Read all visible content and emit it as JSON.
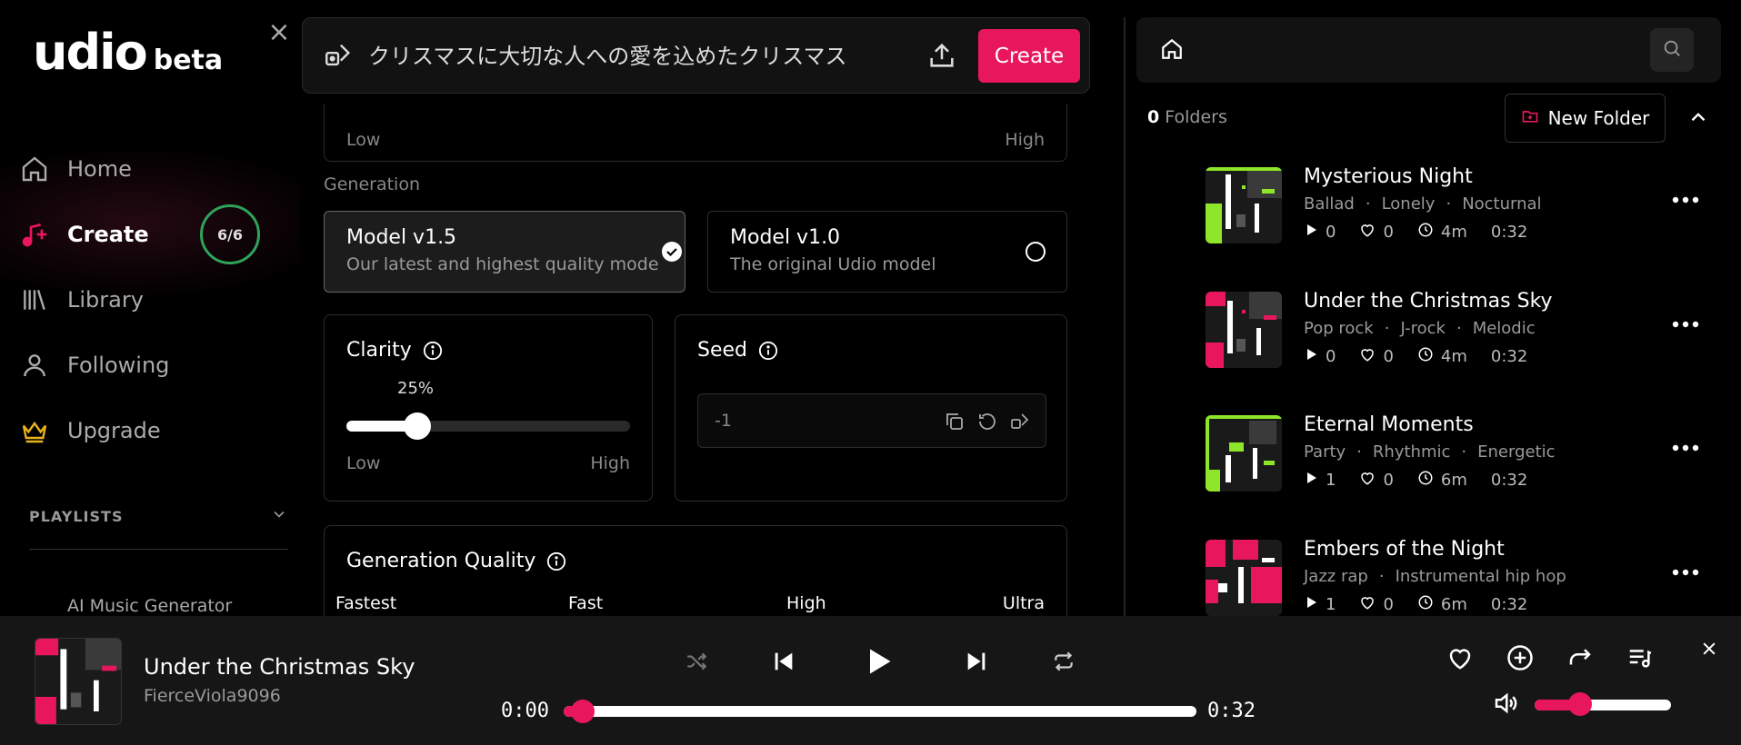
{
  "brand": {
    "name": "udio",
    "badge": "beta"
  },
  "sidebar": {
    "items": [
      {
        "label": "Home",
        "icon": "home-icon"
      },
      {
        "label": "Create",
        "icon": "music-plus-icon",
        "counter": "6/6"
      },
      {
        "label": "Library",
        "icon": "library-icon"
      },
      {
        "label": "Following",
        "icon": "user-icon"
      },
      {
        "label": "Upgrade",
        "icon": "crown-icon"
      }
    ],
    "playlists_heading": "PLAYLISTS",
    "playlists": [
      "AI Music Generator"
    ]
  },
  "prompt": {
    "text": "クリスマスに大切な人への愛を込めたクリスマス",
    "create_label": "Create"
  },
  "settings": {
    "top_low": "Low",
    "top_high": "High",
    "generation_label": "Generation",
    "models": [
      {
        "name": "Model v1.5",
        "desc": "Our latest and highest quality mode",
        "selected": true
      },
      {
        "name": "Model v1.0",
        "desc": "The original Udio model",
        "selected": false
      }
    ],
    "clarity": {
      "title": "Clarity",
      "value_label": "25%",
      "value": 0.25,
      "low": "Low",
      "high": "High"
    },
    "seed": {
      "title": "Seed",
      "value": "-1"
    },
    "quality": {
      "title": "Generation Quality",
      "levels": [
        "Fastest",
        "Fast",
        "High",
        "Ultra"
      ]
    }
  },
  "library": {
    "folder_count": "0",
    "folders_label": "Folders",
    "new_folder_label": "New Folder",
    "songs": [
      {
        "title": "Mysterious Night",
        "tags": [
          "Ballad",
          "Lonely",
          "Nocturnal"
        ],
        "plays": "0",
        "likes": "0",
        "age": "4m",
        "duration": "0:32",
        "accent": "#8ee52a"
      },
      {
        "title": "Under the Christmas Sky",
        "tags": [
          "Pop rock",
          "J-rock",
          "Melodic"
        ],
        "plays": "0",
        "likes": "0",
        "age": "4m",
        "duration": "0:32",
        "accent": "#e8175d"
      },
      {
        "title": "Eternal Moments",
        "tags": [
          "Party",
          "Rhythmic",
          "Energetic"
        ],
        "plays": "1",
        "likes": "0",
        "age": "6m",
        "duration": "0:32",
        "accent": "#8ee52a"
      },
      {
        "title": "Embers of the Night",
        "tags": [
          "Jazz rap",
          "Instrumental hip hop"
        ],
        "plays": "1",
        "likes": "0",
        "age": "6m",
        "duration": "0:32",
        "accent": "#e8175d"
      }
    ]
  },
  "player": {
    "title": "Under the Christmas Sky",
    "artist": "FierceViola9096",
    "current_time": "0:00",
    "total_time": "0:32",
    "progress": 0.03,
    "volume": 0.33
  },
  "colors": {
    "accent": "#e8175d",
    "counter_ring": "#2ea35a",
    "upgrade": "#e8b21a"
  }
}
